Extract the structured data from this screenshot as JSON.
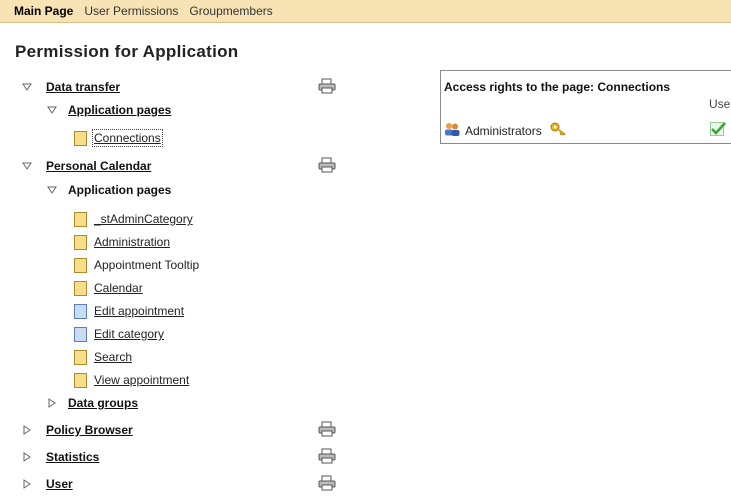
{
  "topbar": {
    "tabs": [
      {
        "label": "Main Page",
        "active": true
      },
      {
        "label": "User Permissions",
        "active": false
      },
      {
        "label": "Groupmembers",
        "active": false
      }
    ]
  },
  "page_title": "Permission for Application",
  "tree": {
    "data_transfer": {
      "label": "Data transfer",
      "expanded": true,
      "app_pages_label": "Application pages",
      "pages": [
        {
          "label": "Connections",
          "icon": "page-yellow-icon",
          "selected": true
        }
      ]
    },
    "personal_calendar": {
      "label": "Personal Calendar",
      "expanded": true,
      "app_pages_label": "Application pages",
      "pages": [
        {
          "label": "_stAdminCategory",
          "icon": "page-yellow-icon"
        },
        {
          "label": "Administration",
          "icon": "page-yellow-icon"
        },
        {
          "label": "Appointment Tooltip",
          "icon": "page-yellow-icon"
        },
        {
          "label": "Calendar",
          "icon": "page-yellow-icon"
        },
        {
          "label": "Edit appointment",
          "icon": "page-blue-icon"
        },
        {
          "label": "Edit category",
          "icon": "page-blue-icon"
        },
        {
          "label": "Search",
          "icon": "page-yellow-icon"
        },
        {
          "label": "View appointment",
          "icon": "page-yellow-icon"
        }
      ],
      "data_groups_label": "Data groups"
    },
    "policy_browser": {
      "label": "Policy Browser",
      "expanded": false
    },
    "statistics": {
      "label": "Statistics",
      "expanded": false
    },
    "user": {
      "label": "User",
      "expanded": false
    }
  },
  "panel": {
    "title": "Access rights to the page: Connections",
    "column_header": "Use",
    "row": {
      "group": "Administrators",
      "allowed": true
    }
  },
  "colors": {
    "topbar_bg": "#f8e3b4",
    "page_yellow": "#f7dc8a",
    "page_blue": "#c9daf3",
    "check_green": "#3aa63a"
  }
}
